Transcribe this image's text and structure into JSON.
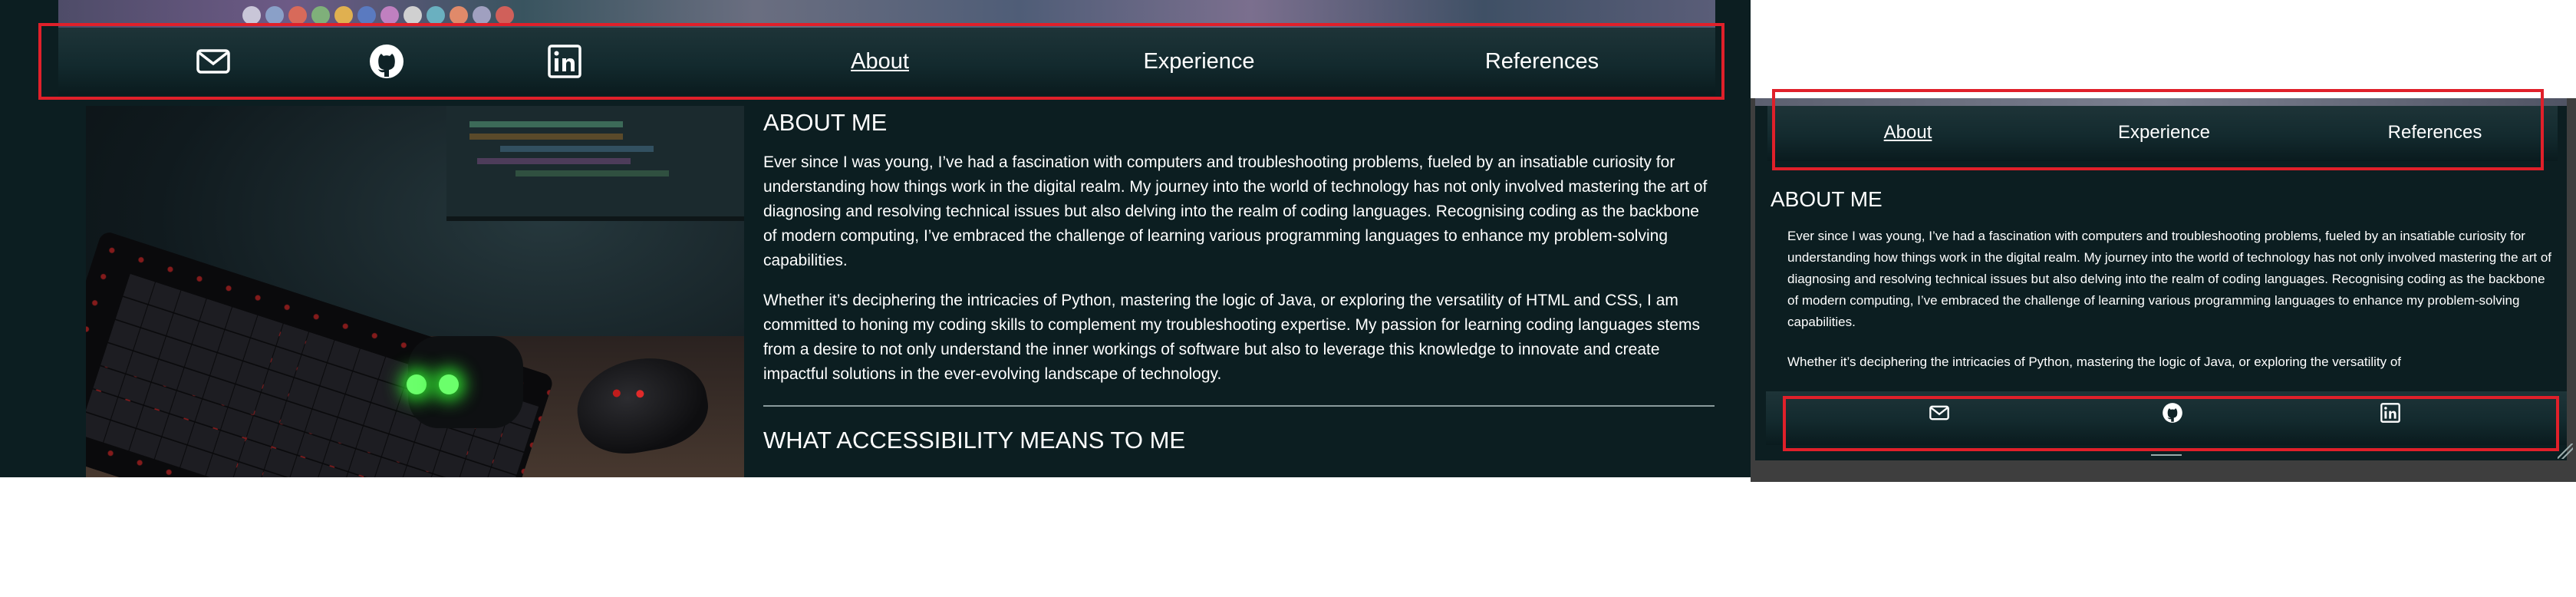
{
  "desktop": {
    "nav": {
      "icons": [
        "envelope-icon",
        "github-icon",
        "linkedin-icon"
      ],
      "links": [
        {
          "label": "About",
          "active": true
        },
        {
          "label": "Experience",
          "active": false
        },
        {
          "label": "References",
          "active": false
        }
      ]
    },
    "about": {
      "heading": "ABOUT ME",
      "paragraphs": [
        "Ever since I was young, I’ve had a fascination with computers and troubleshooting problems, fueled by an insatiable curiosity for understanding how things work in the digital realm. My journey into the world of technology has not only involved mastering the art of diagnosing and resolving technical issues but also delving into the realm of coding languages. Recognising coding as the backbone of modern computing, I’ve embraced the challenge of learning various programming languages to enhance my problem-solving capabilities.",
        "Whether it’s deciphering the intricacies of Python, mastering the logic of Java, or exploring the versatility of HTML and CSS, I am committed to honing my coding skills to complement my troubleshooting expertise. My passion for learning coding languages stems from a desire to not only understand the inner workings of software but also to leverage this knowledge to innovate and create impactful solutions in the ever-evolving landscape of technology."
      ],
      "second_heading": "WHAT ACCESSIBILITY MEANS TO ME"
    }
  },
  "mobile": {
    "nav": {
      "links": [
        {
          "label": "About",
          "active": true
        },
        {
          "label": "Experience",
          "active": false
        },
        {
          "label": "References",
          "active": false
        }
      ]
    },
    "about": {
      "heading": "ABOUT ME",
      "paragraph_1": "Ever since I was young, I’ve had a fascination with computers and troubleshooting problems, fueled by an insatiable curiosity for understanding how things work in the digital realm. My journey into the world of technology has not only involved mastering the art of diagnosing and resolving technical issues but also delving into the realm of coding languages. Recognising coding as the backbone of modern computing, I’ve embraced the challenge of learning various programming languages to enhance my problem-solving capabilities.",
      "paragraph_2_partial": "Whether it’s deciphering the intricacies of Python, mastering the logic of Java, or exploring the versatility of"
    },
    "footer": {
      "icons": [
        "envelope-icon",
        "github-icon",
        "linkedin-icon"
      ]
    }
  },
  "colors": {
    "page_bg": "#0c1e21",
    "nav_gradient_top": "#1e3438",
    "nav_gradient_bottom": "#0a1b1e",
    "highlight_box": "#e0202a",
    "text": "#ffffff"
  }
}
